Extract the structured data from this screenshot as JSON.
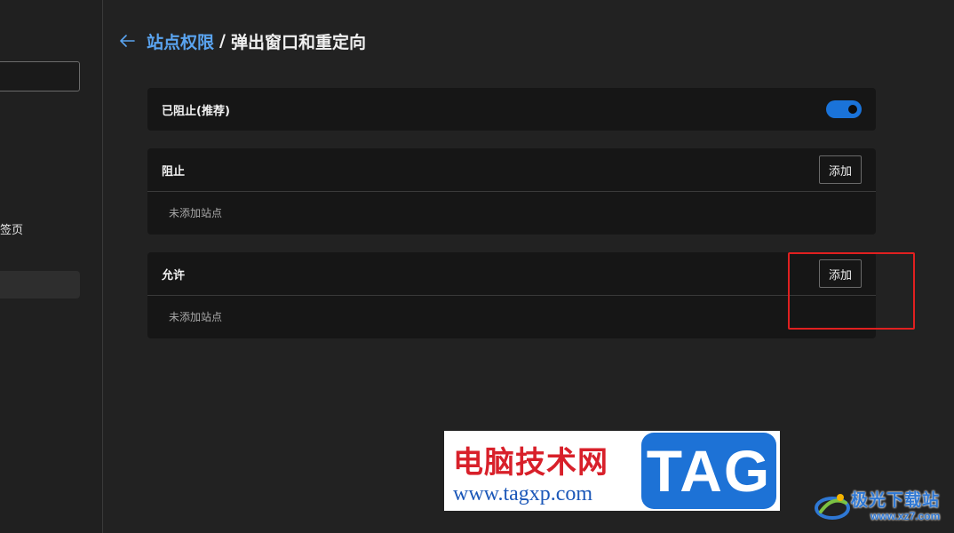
{
  "sidebar": {
    "visible_item_fragment": "签页"
  },
  "header": {
    "breadcrumb_parent": "站点权限",
    "separator": "/",
    "page_title": "弹出窗口和重定向"
  },
  "blocked_recommended": {
    "label": "已阻止(推荐)",
    "toggle_on": true
  },
  "block_section": {
    "title": "阻止",
    "add_label": "添加",
    "empty_text": "未添加站点"
  },
  "allow_section": {
    "title": "允许",
    "add_label": "添加",
    "empty_text": "未添加站点"
  },
  "watermark": {
    "site_name": "电脑技术网",
    "url": "www.tagxp.com",
    "badge": "TAG"
  },
  "logo_watermark": {
    "name": "极光下载站",
    "url": "www.xz7.com"
  },
  "colors": {
    "background": "#222222",
    "card": "#161616",
    "accent": "#5aa4f0",
    "toggle": "#1a73d9",
    "highlight": "#e02020"
  }
}
